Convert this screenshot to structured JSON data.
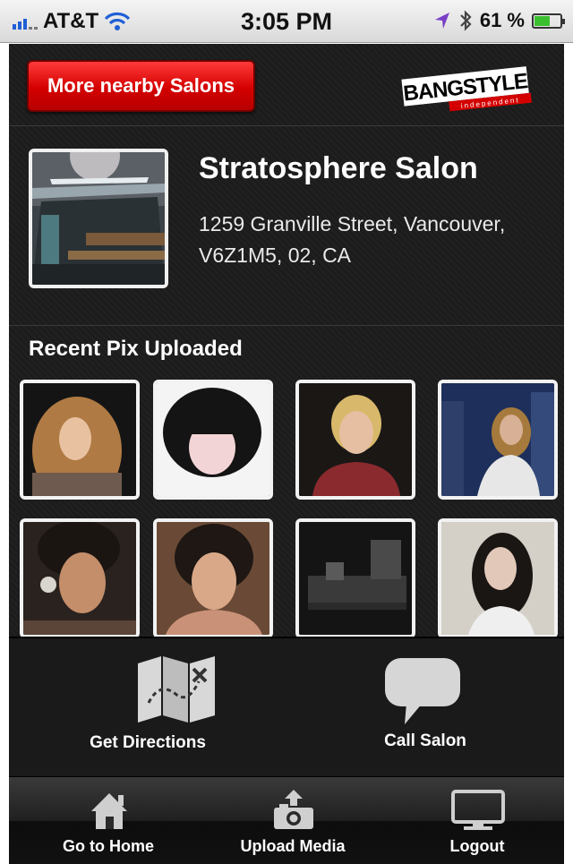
{
  "status_bar": {
    "carrier": "AT&T",
    "time": "3:05 PM",
    "battery": "61 %",
    "battery_level": 0.61
  },
  "header": {
    "nearby_button": "More nearby Salons",
    "logo_text": "BANGSTYLE",
    "logo_subtext": "independent"
  },
  "salon": {
    "name": "Stratosphere Salon",
    "address_line1": "1259 Granville Street, Vancouver,",
    "address_line2": "V6Z1M5, 02, CA"
  },
  "recent_pix": {
    "title": "Recent Pix Uploaded"
  },
  "actions": {
    "directions": "Get Directions",
    "call": "Call Salon"
  },
  "tabs": {
    "home": "Go to Home",
    "upload": "Upload Media",
    "logout": "Logout"
  },
  "colors": {
    "accent_red": "#d40000",
    "screen_bg": "#1c1c1c"
  }
}
